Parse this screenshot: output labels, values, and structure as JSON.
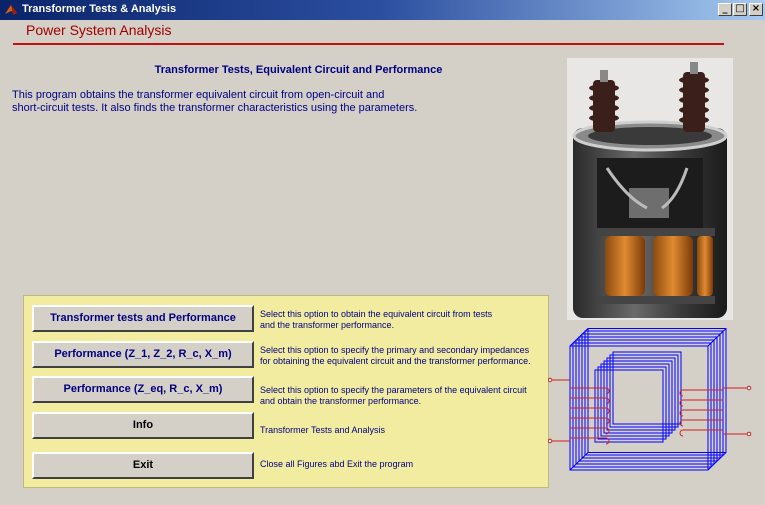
{
  "window": {
    "title": "Transformer Tests & Analysis",
    "minimize_glyph": "_",
    "maximize_glyph": "□",
    "close_glyph": "×"
  },
  "header": {
    "title": "Power System Analysis"
  },
  "main": {
    "subtitle": "Transformer Tests, Equivalent Circuit and Performance",
    "description_lines": [
      "This program obtains the transformer equivalent circuit from open-circuit and",
      "short-circuit tests. It also finds the transformer characteristics using the parameters."
    ]
  },
  "options": [
    {
      "label": "Transformer tests and Performance",
      "desc_lines": [
        "Select this option to obtain the equivalent circuit from tests",
        "and the transformer performance."
      ]
    },
    {
      "label": "Performance (Z_1, Z_2, R_c, X_m)",
      "desc_lines": [
        "Select this option to specify the primary and secondary impedances",
        "for obtaining the equivalent circuit and the transformer performance."
      ]
    },
    {
      "label": "Performance (Z_eq, R_c, X_m)",
      "desc_lines": [
        "Select this option to specify the parameters of the equivalent circuit",
        "and obtain the transformer performance."
      ]
    },
    {
      "label": "Info",
      "desc_lines": [
        "Transformer Tests and Analysis"
      ]
    },
    {
      "label": "Exit",
      "desc_lines": [
        "Close all Figures abd Exit the program"
      ]
    }
  ],
  "icons": {
    "app": "matlab-icon",
    "photo": "transformer-photo",
    "diagram": "transformer-core-diagram"
  },
  "colors": {
    "title_red": "#a00000",
    "text_blue": "#000080",
    "panel_yellow": "#f2eca0",
    "core_blue": "#0000ff",
    "winding_red": "#d02020"
  }
}
